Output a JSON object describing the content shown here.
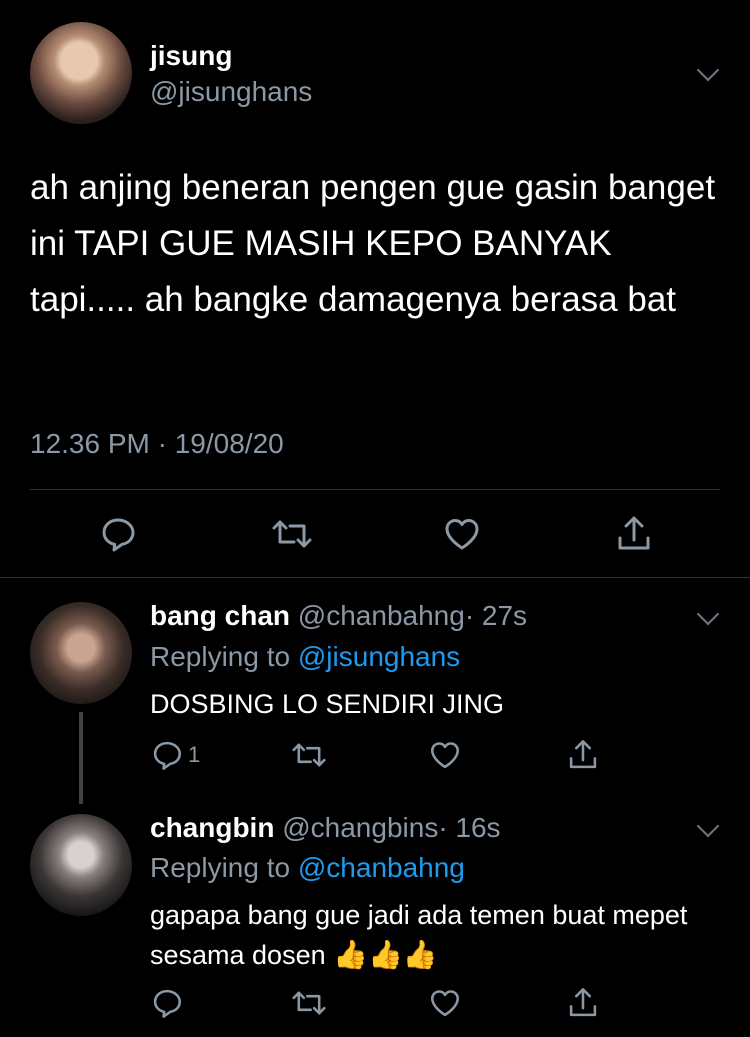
{
  "main_tweet": {
    "display_name": "jisung",
    "handle": "@jisunghans",
    "text": "ah anjing beneran pengen gue gasin banget ini TAPI GUE MASIH KEPO BANYAK tapi..... ah bangke damagenya berasa bat",
    "timestamp": "12.36 PM · 19/08/20"
  },
  "replies": [
    {
      "display_name": "bang chan",
      "handle": "@chanbahng",
      "time": "· 27s",
      "replying_prefix": "Replying to",
      "replying_to": "@jisunghans",
      "text": "DOSBING LO SENDIRI JING",
      "reply_count": "1"
    },
    {
      "display_name": "changbin",
      "handle": "@changbins",
      "time": "· 16s",
      "replying_prefix": "Replying to",
      "replying_to": "@chanbahng",
      "text": "gapapa bang gue jadi ada temen buat mepet sesama dosen",
      "emoji": "👍👍👍",
      "reply_count": ""
    }
  ],
  "icons": [
    "chevron-down-icon",
    "reply-icon",
    "retweet-icon",
    "like-icon",
    "share-icon"
  ],
  "colors": {
    "background": "#000000",
    "text": "#ffffff",
    "muted": "#8b98a5",
    "link": "#1d9bf0"
  }
}
